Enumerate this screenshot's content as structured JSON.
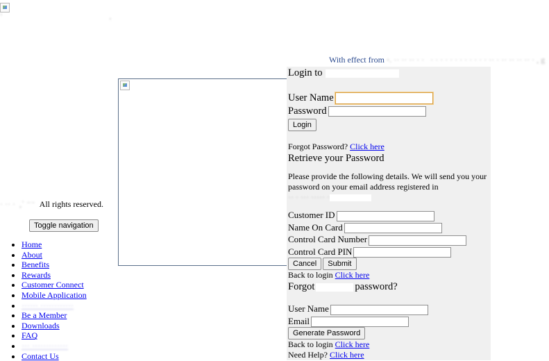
{
  "header": {
    "logo_icon": "broken-image-icon",
    "ticker_text": "With effect from"
  },
  "footer": {
    "rights_text": "All rights reserved."
  },
  "nav": {
    "toggle_label": "Toggle navigation",
    "items": [
      {
        "label": "Home"
      },
      {
        "label": "About"
      },
      {
        "label": "Benefits"
      },
      {
        "label": "Rewards"
      },
      {
        "label": "Customer Connect"
      },
      {
        "label": "Mobile Application"
      },
      {
        "label": ""
      },
      {
        "label": "Be a Member"
      },
      {
        "label": "Downloads"
      },
      {
        "label": "FAQ"
      },
      {
        "label": ""
      },
      {
        "label": "Contact Us"
      }
    ]
  },
  "login": {
    "title": "Login to",
    "username_label": "User Name",
    "password_label": "Password",
    "login_button": "Login",
    "forgot_prefix": "Forgot Password?",
    "forgot_link": "Click here"
  },
  "retrieve": {
    "title": "Retrieve your Password",
    "description": "Please provide the following details. We will send you your password on your email address registered in",
    "customer_id_label": "Customer ID",
    "name_on_card_label": "Name On Card",
    "control_card_number_label": "Control Card Number",
    "control_card_pin_label": "Control Card PIN",
    "cancel_button": "Cancel",
    "submit_button": "Submit",
    "back_prefix": "Back to login",
    "back_link": "Click here"
  },
  "forgot_section": {
    "title_prefix": "Forgot",
    "title_suffix": "password?",
    "username_label": "User Name",
    "email_label": "Email",
    "generate_button": "Generate Password",
    "back_prefix": "Back to login",
    "back_link": "Click here",
    "help_prefix": "Need Help?",
    "help_link": "Click here"
  }
}
